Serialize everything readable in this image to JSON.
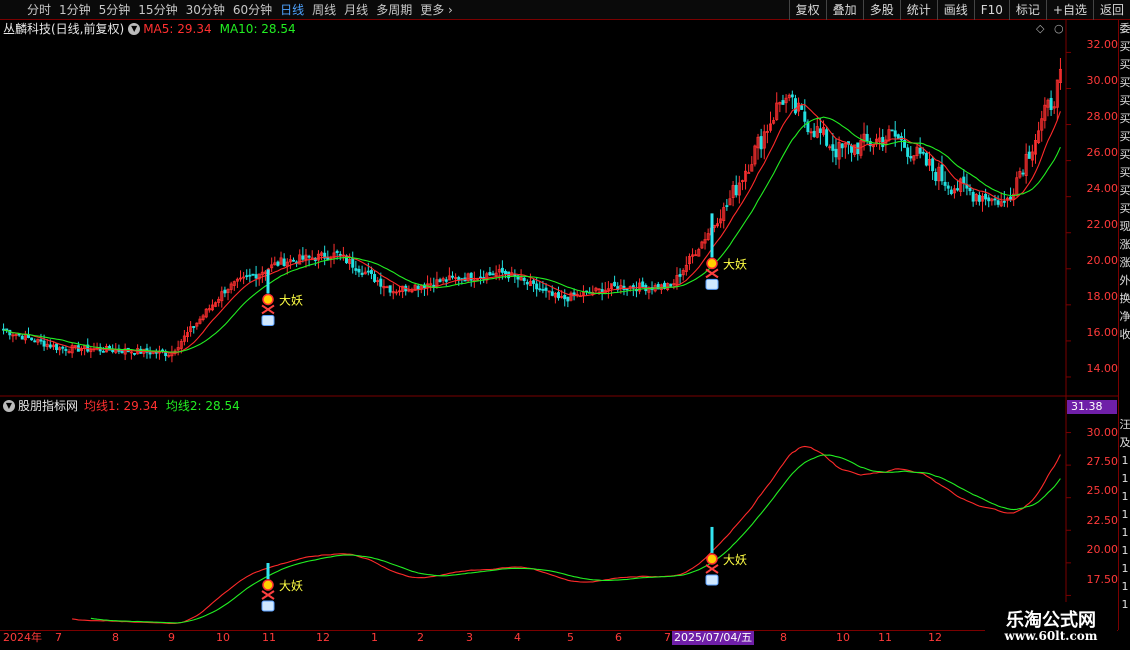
{
  "toolbar": {
    "timeframes": [
      "分时",
      "1分钟",
      "5分钟",
      "15分钟",
      "30分钟",
      "60分钟",
      "日线",
      "周线",
      "月线",
      "多周期",
      "更多"
    ],
    "active_timeframe": "日线",
    "right_buttons": [
      "复权",
      "叠加",
      "多股",
      "统计",
      "画线",
      "F10",
      "标记",
      "+自选",
      "返回"
    ]
  },
  "main_panel": {
    "stock_label": "丛麟科技(日线,前复权)",
    "ma5_label": "MA5: 29.34",
    "ma10_label": "MA10: 28.54",
    "signal_text": "大妖",
    "axis_labels": [
      "32.00",
      "30.00",
      "28.00",
      "26.00",
      "24.00",
      "22.00",
      "20.00",
      "18.00",
      "16.00",
      "14.00"
    ]
  },
  "sub_panel": {
    "indicator_name": "股朋指标网",
    "line1_label": "均线1: 29.34",
    "line2_label": "均线2: 28.54",
    "signal_text": "大妖",
    "axis_labels": [
      "30.00",
      "27.50",
      "25.00",
      "22.50",
      "20.00",
      "17.50"
    ],
    "current_value": "31.38"
  },
  "side_column": {
    "chars": [
      "委",
      "买",
      "买",
      "买",
      "买",
      "买",
      "买",
      "买",
      "买",
      "买",
      "买",
      "现",
      "涨",
      "涨",
      "外",
      "换",
      "净",
      "收",
      "",
      "",
      "",
      "",
      "汪",
      "及",
      "1",
      "1",
      "1",
      "1",
      "1",
      "1",
      "1",
      "1",
      "1"
    ]
  },
  "date_axis": {
    "labels": [
      "2024年",
      "7",
      "8",
      "9",
      "10",
      "11",
      "12",
      "1",
      "2",
      "3",
      "4",
      "5",
      "6",
      "7",
      "8",
      "9",
      "10",
      "11",
      "12"
    ],
    "cursor_date": "2025/07/04/五"
  },
  "watermark": {
    "title": "乐淘公式网",
    "url": "www.60lt.com"
  },
  "colors": {
    "up": "#ff3030",
    "down": "#22e0e0",
    "ma5": "#ff2a2a",
    "ma10": "#22ee22",
    "signal_bar": "#33e6f2",
    "signal_text": "#ffff44",
    "grid": "#7a0000",
    "accent": "#6f1fa8"
  },
  "chart_data": {
    "type": "candlestick",
    "title": "丛麟科技(日线,前复权)",
    "period": "日线",
    "ylim": [
      13.0,
      32.8
    ],
    "last_ma5": 29.34,
    "last_ma10": 28.54,
    "anchor_closes": [
      {
        "date": "2024-06",
        "close": 16.6
      },
      {
        "date": "2024-07",
        "close": 15.6
      },
      {
        "date": "2024-08",
        "close": 15.5
      },
      {
        "date": "2024-09",
        "close": 15.3
      },
      {
        "date": "2024-10",
        "close": 18.9
      },
      {
        "date": "2024-11",
        "close": 20.4
      },
      {
        "date": "2024-12",
        "close": 20.8
      },
      {
        "date": "2025-01",
        "close": 18.8
      },
      {
        "date": "2025-02",
        "close": 19.4
      },
      {
        "date": "2025-03",
        "close": 19.8
      },
      {
        "date": "2025-04",
        "close": 18.3
      },
      {
        "date": "2025-05",
        "close": 19.0
      },
      {
        "date": "2025-06",
        "close": 19.0
      },
      {
        "date": "2025-07",
        "close": 23.5
      },
      {
        "date": "2025-08",
        "close": 29.5
      },
      {
        "date": "2025-09",
        "close": 26.5
      },
      {
        "date": "2025-10",
        "close": 27.4
      },
      {
        "date": "2025-11",
        "close": 24.7
      },
      {
        "date": "2025-12",
        "close": 23.6
      },
      {
        "date": "2026-01",
        "close": 30.4
      }
    ],
    "signals": [
      {
        "label": "大妖",
        "date": "2024-11",
        "price": 18.3
      },
      {
        "label": "大妖",
        "date": "2025-07-04",
        "price": 20.3
      }
    ],
    "sub_indicator": {
      "name": "股朋指标网",
      "ylim": [
        15.0,
        31.5
      ],
      "series": [
        {
          "name": "均线1",
          "last": 29.34
        },
        {
          "name": "均线2",
          "last": 28.54
        }
      ]
    }
  }
}
